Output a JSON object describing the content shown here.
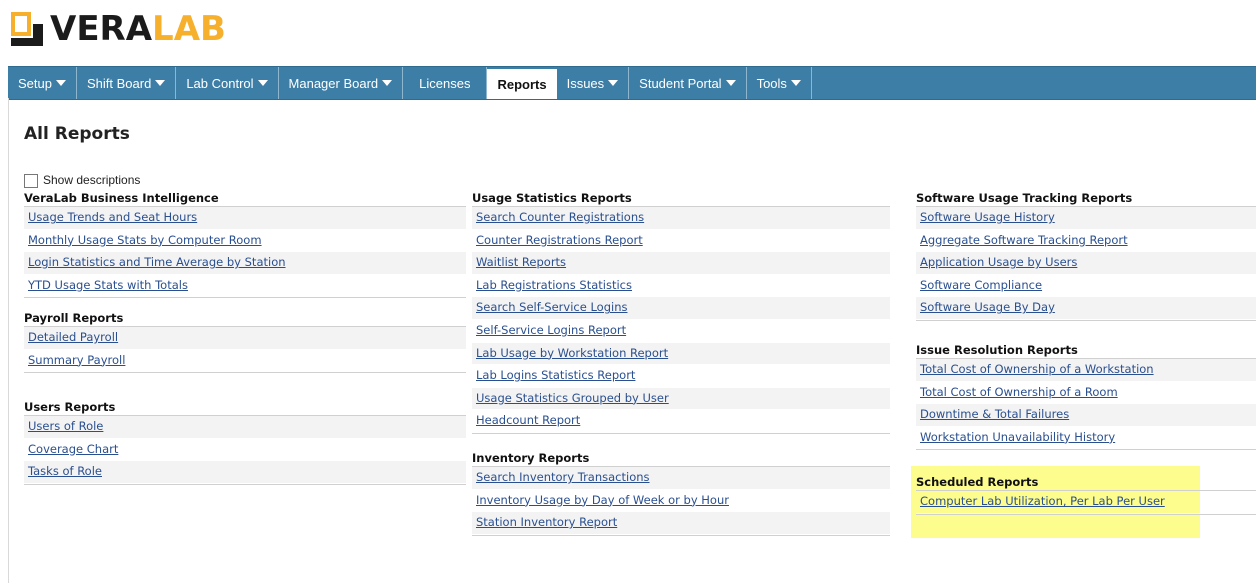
{
  "logo": {
    "part1": "VERA",
    "part2": "LAB"
  },
  "nav": {
    "items": [
      {
        "label": "Setup",
        "dropdown": true
      },
      {
        "label": "Shift Board",
        "dropdown": true
      },
      {
        "label": "Lab Control",
        "dropdown": true
      },
      {
        "label": "Manager Board",
        "dropdown": true
      },
      {
        "label": "Licenses",
        "dropdown": false
      },
      {
        "label": "Reports",
        "dropdown": false,
        "active": true
      },
      {
        "label": "Issues",
        "dropdown": true
      },
      {
        "label": "Student Portal",
        "dropdown": true
      },
      {
        "label": "Tools",
        "dropdown": true
      }
    ]
  },
  "page": {
    "title": "All Reports",
    "show_descriptions": "Show descriptions"
  },
  "columns": {
    "col1": [
      {
        "title": "VeraLab Business Intelligence",
        "links": [
          "Usage Trends and Seat Hours",
          "Monthly Usage Stats by Computer Room",
          "Login Statistics and Time Average by Station",
          "YTD Usage Stats with Totals"
        ]
      },
      {
        "title": "Payroll Reports",
        "links": [
          "Detailed Payroll",
          "Summary Payroll"
        ]
      },
      {
        "title": "Users Reports",
        "links": [
          "Users of Role",
          "Coverage Chart",
          "Tasks of Role"
        ]
      }
    ],
    "col2": [
      {
        "title": "Usage Statistics Reports",
        "links": [
          "Search Counter Registrations",
          "Counter Registrations Report",
          "Waitlist Reports",
          "Lab Registrations Statistics",
          "Search Self-Service Logins",
          "Self-Service Logins Report",
          "Lab Usage by Workstation Report",
          "Lab Logins Statistics Report",
          "Usage Statistics Grouped by User",
          "Headcount Report"
        ]
      },
      {
        "title": "Inventory Reports",
        "links": [
          "Search Inventory Transactions",
          "Inventory Usage by Day of Week or by Hour",
          "Station Inventory Report"
        ]
      }
    ],
    "col3": [
      {
        "title": "Software Usage Tracking Reports",
        "links": [
          "Software Usage History",
          "Aggregate Software Tracking Report",
          "Application Usage by Users",
          "Software Compliance",
          "Software Usage By Day"
        ]
      },
      {
        "title": "Issue Resolution Reports",
        "links": [
          "Total Cost of Ownership of a Workstation",
          "Total Cost of Ownership of a Room",
          "Downtime & Total Failures",
          "Workstation Unavailability History"
        ]
      },
      {
        "title": "Scheduled Reports",
        "links": [
          "Computer Lab Utilization, Per Lab Per User"
        ]
      }
    ]
  },
  "colors": {
    "nav_bg": "#3d7ea6",
    "link": "#2a4f8f",
    "logo_accent": "#f7b02c",
    "highlight": "#fdfd7a"
  }
}
